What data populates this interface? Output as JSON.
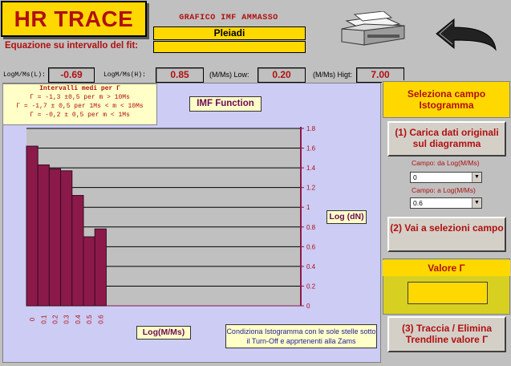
{
  "app_title": "HR TRACE",
  "header": {
    "chart_caption": "GRAFICO IMF AMMASSO",
    "cluster_name": "Pleiadi",
    "fit_equation_label": "Equazione su intervallo del fit:",
    "fit_equation_value": ""
  },
  "range_row": {
    "low_label": "LogM/Ms(L):",
    "low_value": "-0.69",
    "high_label": "LogM/Ms(H):",
    "high_value": "0.85",
    "mms_low_label": "(M/Ms) Low:",
    "mms_low_value": "0.20",
    "mms_high_label": "(M/Ms) Higt:",
    "mms_high_value": "7.00"
  },
  "gamma_info": {
    "title": "Intervalli medi per Γ",
    "lines": [
      "Γ = -1,3 ±0,5 per m > 10Ms",
      "Γ = -1,7 ± 0,5 per 1Ms < m < 10Ms",
      "Γ = -0,2 ± 0,5 per m < 1Ms"
    ]
  },
  "panel": {
    "select_field_button": "Seleziona campo Istogramma",
    "load_data_button": "(1) Carica dati originali sul diagramma",
    "from_label": "Campo: da Log(M/Ms)",
    "from_value": "0",
    "to_label": "Campo:  a Log(M/Ms)",
    "to_value": "0.6",
    "goto_select_button": "(2) Vai a selezioni campo",
    "gamma_value_label": "Valore Γ",
    "gamma_value": "",
    "trend_button": "(3) Traccia / Elimina Trendline valore Γ"
  },
  "notes": {
    "condition": "Condiziona Istogramma con le sole stelle sotto il Turn-Off e apprtenenti alla Zams"
  },
  "colors": {
    "accent_yellow": "#ffd800",
    "bar_color": "#8b1a4a",
    "title_red": "#b01010",
    "plot_bg": "#ccccf5"
  },
  "icons": [
    "printer-icon",
    "return-arrow-icon"
  ],
  "chart_data": {
    "type": "bar",
    "title": "IMF  Function",
    "xlabel": "Log(M/Ms)",
    "ylabel": "Log (dN)",
    "categories": [
      "0",
      "0.1",
      "0.2",
      "0.3",
      "0.4",
      "0.5",
      "0.6"
    ],
    "values": [
      1.62,
      1.43,
      1.39,
      1.37,
      1.12,
      0.7,
      0.78
    ],
    "ylim": [
      0,
      1.8
    ],
    "yticks": [
      "0",
      "0.2",
      "0.4",
      "0.6",
      "0.8",
      "1",
      "1.2",
      "1.4",
      "1.6",
      "1.8"
    ],
    "grid": true
  }
}
